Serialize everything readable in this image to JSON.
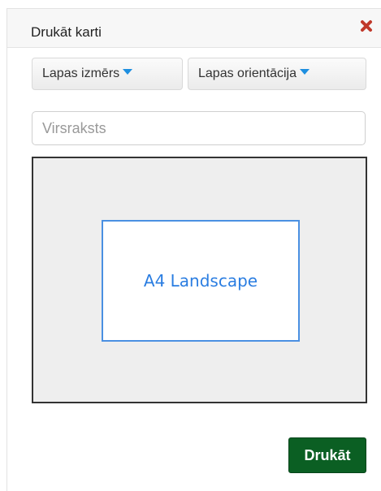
{
  "panel": {
    "title": "Drukāt karti",
    "close_icon": "close-x-icon"
  },
  "toolbar": {
    "page_size_label": "Lapas izmērs",
    "page_orientation_label": "Lapas orientācija",
    "dropdown_icon": "caret-down-icon"
  },
  "title_field": {
    "placeholder": "Virsraksts",
    "value": ""
  },
  "preview": {
    "page_label": "A4 Landscape"
  },
  "actions": {
    "print_label": "Drukāt"
  },
  "colors": {
    "accent": "#1e8fe0",
    "page_border": "#4a90e2",
    "print_button": "#0b5f23",
    "close_icon": "#c0392b"
  }
}
